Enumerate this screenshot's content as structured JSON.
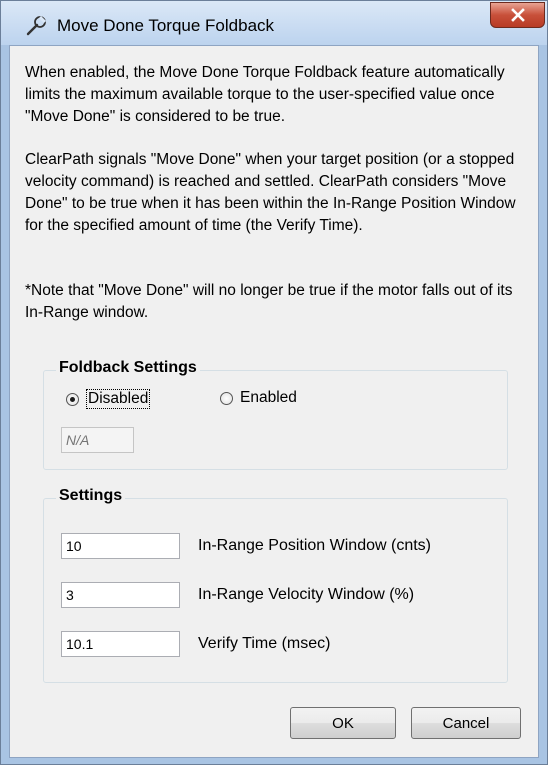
{
  "window": {
    "title": "Move Done Torque Foldback",
    "close_label": "X"
  },
  "description": {
    "paragraph1": "When enabled, the Move Done Torque Foldback feature automatically limits the maximum available torque to the user-specified value once \"Move Done\" is considered to be true.",
    "paragraph2": "ClearPath signals \"Move Done\" when your target position (or a stopped velocity command) is reached and settled. ClearPath considers \"Move Done\" to be true when it has been within the In-Range Position Window for the specified amount of time (the Verify Time).",
    "note": "*Note that \"Move Done\" will no longer be true if the motor falls out of its In-Range window."
  },
  "foldback_settings": {
    "title": "Foldback Settings",
    "options": [
      {
        "label": "Disabled",
        "checked": true
      },
      {
        "label": "Enabled",
        "checked": false
      }
    ],
    "value_placeholder": "N/A"
  },
  "settings": {
    "title": "Settings",
    "fields": [
      {
        "value": "10",
        "label": "In-Range Position Window (cnts)"
      },
      {
        "value": "3",
        "label": "In-Range Velocity Window (%)"
      },
      {
        "value": "10.1",
        "label": "Verify Time (msec)"
      }
    ]
  },
  "buttons": {
    "ok": "OK",
    "cancel": "Cancel"
  }
}
